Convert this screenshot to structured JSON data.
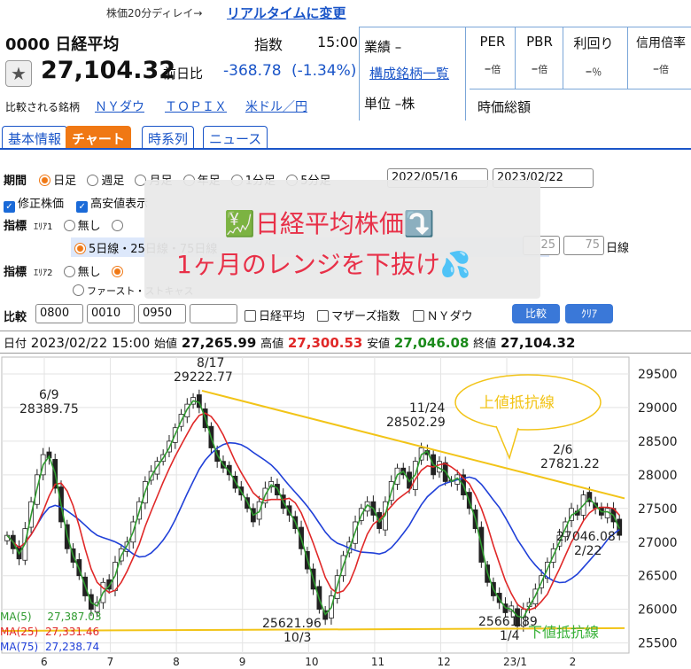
{
  "delay_notice": "株価20分ディレイ→",
  "realtime_link": "リアルタイムに変更",
  "code_name": "0000 日経平均",
  "category": "指数",
  "time": "15:00",
  "price": "27,104.32",
  "change_label": "前日比",
  "change": "-368.78",
  "change_pct": "(-1.34%)",
  "compare_label": "比較される銘柄",
  "compare_links": [
    "ＮＹダウ",
    "ＴＯＰＩＸ",
    "米ドル／円"
  ],
  "gyoseki": "業績 –",
  "components_link": "構成銘柄一覧",
  "unit": "単位 –株",
  "metrics": [
    {
      "label": "PER",
      "value": "–",
      "unit": "倍"
    },
    {
      "label": "PBR",
      "value": "–",
      "unit": "倍"
    },
    {
      "label": "利回り",
      "value": "–",
      "unit": "％"
    },
    {
      "label": "信用倍率",
      "value": "–",
      "unit": "倍"
    }
  ],
  "market_cap_label": "時価総額",
  "tabs": [
    "基本情報",
    "チャート",
    "時系列",
    "ニュース"
  ],
  "period_label": "期間",
  "period_opts": [
    "日足",
    "週足",
    "月足",
    "年足",
    "1分足",
    "5分足"
  ],
  "date_from": "2022/05/16",
  "date_to": "2023/02/22",
  "adj_price": "修正株価",
  "high_low": "高安値表示",
  "indicator_label": "指標",
  "area1": "ｴﾘｱ1",
  "area2": "ｴﾘｱ2",
  "none_opt": "無し",
  "ma_opt": "5日線・25日線・75日線",
  "ma_v1": "25",
  "ma_v2": "75",
  "ma_suffix": "日線",
  "first_opt": "ファースト・ストキャス",
  "compare_row_label": "比較",
  "compare_codes": [
    "0800",
    "0010",
    "0950",
    ""
  ],
  "compare_checks": [
    "日経平均",
    "マザーズ指数",
    "ＮＹダウ"
  ],
  "compare_btn": "比較",
  "clear_btn": "ｸﾘｱ",
  "overlay": {
    "line1": "日経平均株価",
    "line2": "1ヶ月のレンジを下抜け",
    "emoji1": "💹",
    "emoji2": "⤵️",
    "emoji3": "💦"
  },
  "ohlc": {
    "date_label": "日付",
    "date": "2023/02/22 15:00",
    "open_label": "始値",
    "open": "27,265.99",
    "high_label": "高値",
    "high": "27,300.53",
    "low_label": "安値",
    "low": "27,046.08",
    "close_label": "終値",
    "close": "27,104.32"
  },
  "ma_legend": [
    {
      "label": "MA(5)",
      "value": "27,387.03",
      "color": "#2e9a2e"
    },
    {
      "label": "MA(25)",
      "value": "27,331.46",
      "color": "#e02828"
    },
    {
      "label": "MA(75)",
      "value": "27,238.74",
      "color": "#2040d8"
    }
  ],
  "annot_upper": "上値抵抗線",
  "annot_lower": "下値抵抗線",
  "chart_data": {
    "type": "candlestick",
    "x_ticks": [
      "6",
      "7",
      "8",
      "9",
      "10",
      "11",
      "12",
      "23/1",
      "2"
    ],
    "y_ticks": [
      25500,
      26000,
      26500,
      27000,
      27500,
      28000,
      28500,
      29000,
      29500
    ],
    "ylim": [
      25350,
      29750
    ],
    "labels": [
      {
        "date": "6/9",
        "value": "28389.75"
      },
      {
        "date": "8/17",
        "value": "29222.77"
      },
      {
        "date": "10/3",
        "value": "25621.96"
      },
      {
        "date": "11/24",
        "value": "28502.29"
      },
      {
        "date": "1/4",
        "value": "25661.89"
      },
      {
        "date": "2/6",
        "value": "27821.22"
      },
      {
        "date": "2/22",
        "value": "27046.08"
      }
    ],
    "upper_line": [
      29250,
      27650
    ],
    "lower_line": [
      25680,
      25720
    ],
    "closes": [
      27100,
      26900,
      26750,
      27200,
      27600,
      28000,
      28300,
      28250,
      27800,
      27300,
      26900,
      26700,
      26500,
      26200,
      26000,
      26100,
      26400,
      26300,
      26700,
      26900,
      27000,
      27300,
      27600,
      27900,
      28050,
      28200,
      28300,
      28500,
      28700,
      28900,
      29050,
      29150,
      29000,
      28700,
      28400,
      28200,
      28100,
      28000,
      27800,
      27700,
      27500,
      27300,
      27600,
      27800,
      27900,
      27700,
      27500,
      27400,
      27200,
      26900,
      26600,
      26300,
      26000,
      25850,
      26200,
      26500,
      26800,
      27000,
      27300,
      27500,
      27600,
      27400,
      27200,
      27600,
      27900,
      28100,
      28000,
      27800,
      28200,
      28400,
      28300,
      28000,
      28200,
      27900,
      27900,
      28000,
      27700,
      27500,
      27200,
      26700,
      26400,
      26200,
      26100,
      25950,
      26050,
      25750,
      26000,
      26100,
      26300,
      26500,
      26700,
      26900,
      27100,
      27300,
      27500,
      27400,
      27700,
      27600,
      27500,
      27400,
      27500,
      27300,
      27100
    ]
  }
}
